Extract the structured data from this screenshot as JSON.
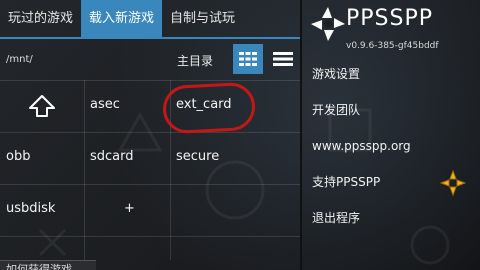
{
  "tabs": [
    "玩过的游戏",
    "载入新游戏",
    "自制与试玩"
  ],
  "active_tab": 1,
  "browser": {
    "path": "/mnt/",
    "home_label": "主目录",
    "items": [
      {
        "label": ""
      },
      {
        "label": "asec"
      },
      {
        "label": "ext_card"
      },
      {
        "label": "obb"
      },
      {
        "label": "sdcard"
      },
      {
        "label": "secure"
      },
      {
        "label": "usbdisk"
      },
      {
        "label": "+"
      },
      {
        "label": ""
      }
    ],
    "bottom_label": "如何获得游戏"
  },
  "brand": {
    "name": "PPSSPP",
    "version": "v0.9.6-385-gf45bddf"
  },
  "menu": [
    {
      "label": "游戏设置"
    },
    {
      "label": "开发团队"
    },
    {
      "label": "www.ppsspp.org"
    },
    {
      "label": "支持PPSSPP"
    },
    {
      "label": "退出程序"
    }
  ],
  "colors": {
    "accent": "#3a87bd",
    "annotation": "#c41818",
    "background": "#1d1f22"
  },
  "icons": [
    "up-arrow-icon",
    "grid-view-icon",
    "list-view-icon",
    "psp-logo-icon",
    "gold-psp-icon"
  ]
}
